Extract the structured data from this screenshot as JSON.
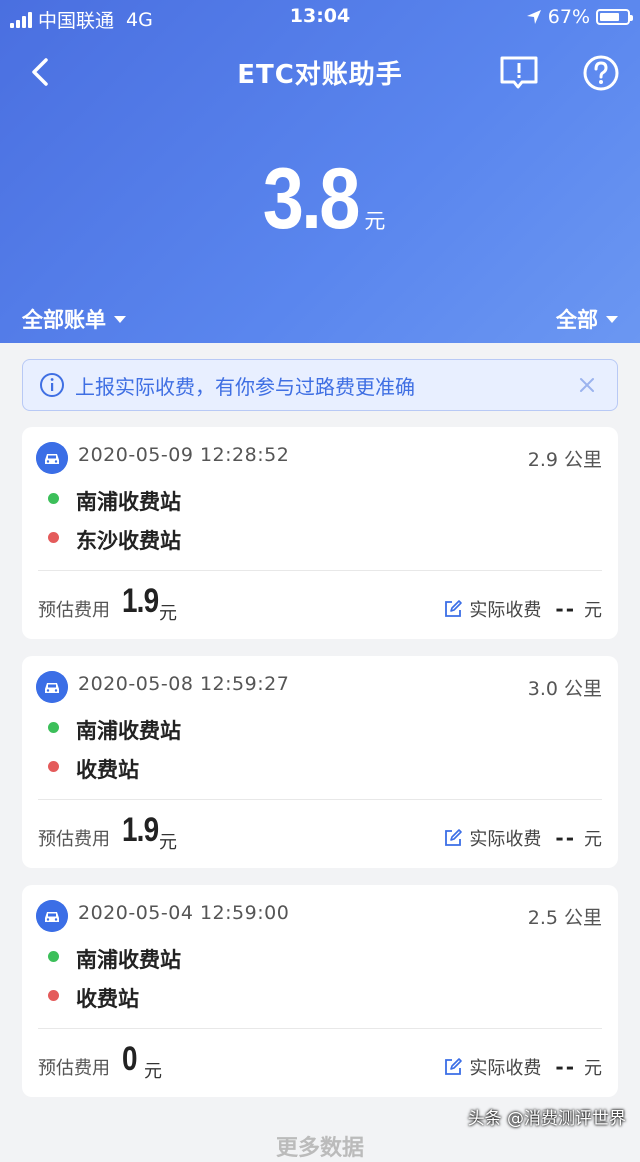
{
  "status_bar": {
    "carrier": "中国联通",
    "network": "4G",
    "time": "13:04",
    "battery": "67%"
  },
  "nav": {
    "title": "ETC对账助手",
    "back_icon": "chevron-left-icon",
    "feedback_icon": "feedback-icon",
    "help_icon": "help-icon"
  },
  "summary": {
    "amount": "3.8",
    "unit": "元"
  },
  "filters": {
    "left": "全部账单",
    "right": "全部"
  },
  "notice": {
    "text": "上报实际收费，有你参与过路费更准确"
  },
  "records": [
    {
      "time": "2020-05-09 12:28:52",
      "distance": "2.9 公里",
      "from": "南浦收费站",
      "to": "东沙收费站",
      "est_label": "预估费用",
      "est_amount": "1.9",
      "est_unit": "元",
      "actual_label": "实际收费",
      "actual_value": "--",
      "actual_unit": "元"
    },
    {
      "time": "2020-05-08 12:59:27",
      "distance": "3.0 公里",
      "from": "南浦收费站",
      "to": "收费站",
      "est_label": "预估费用",
      "est_amount": "1.9",
      "est_unit": "元",
      "actual_label": "实际收费",
      "actual_value": "--",
      "actual_unit": "元"
    },
    {
      "time": "2020-05-04 12:59:00",
      "distance": "2.5 公里",
      "from": "南浦收费站",
      "to": "收费站",
      "est_label": "预估费用",
      "est_amount": "0",
      "est_unit": "元",
      "actual_label": "实际收费",
      "actual_value": "--",
      "actual_unit": "元"
    }
  ],
  "footer": {
    "text": "更多数据"
  },
  "watermark": "头条 @消费测评世界",
  "colors": {
    "header_blue": "#4a6fe0",
    "accent_blue": "#3b6ee6",
    "green_dot": "#3cbf5a",
    "red_dot": "#e45b5b"
  }
}
